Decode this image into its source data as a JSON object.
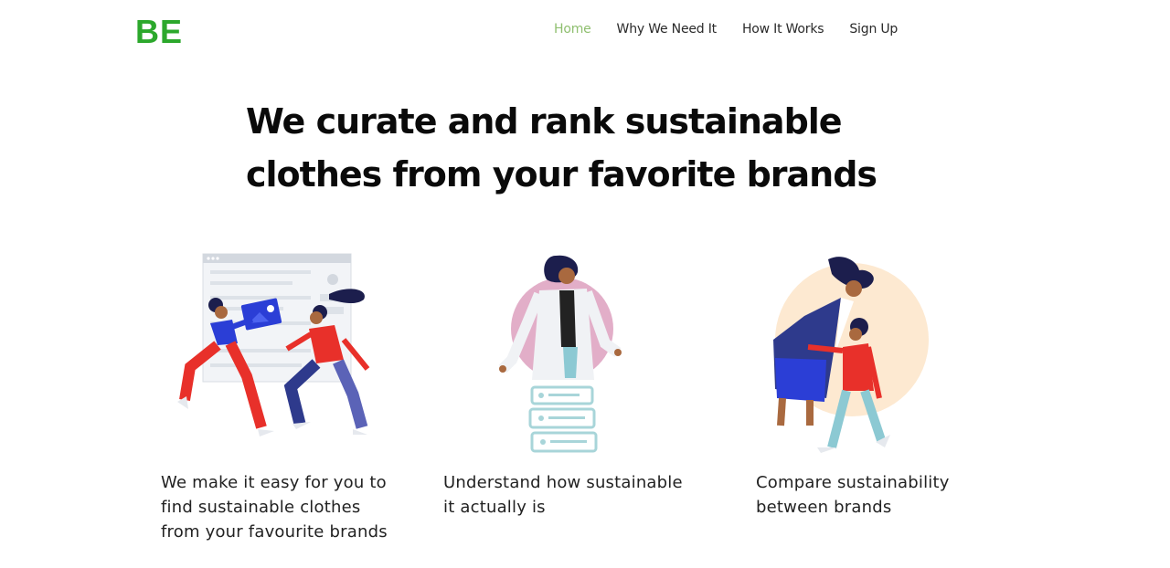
{
  "brand": {
    "logo_text": "BE",
    "accent": "#2ca82c"
  },
  "nav": {
    "items": [
      {
        "label": "Home",
        "active": true
      },
      {
        "label": "Why We Need It",
        "active": false
      },
      {
        "label": "How It Works",
        "active": false
      },
      {
        "label": "Sign Up",
        "active": false
      }
    ],
    "active_color": "#8fbf6f"
  },
  "hero": {
    "headline_line1": "We curate and rank sustainable",
    "headline_line2": "clothes from your favorite brands"
  },
  "features": [
    {
      "illustration": "two-people-sharing-webpage-illustration",
      "line1": "We make it easy for you to",
      "line2": "find sustainable clothes",
      "line3": "from your favourite brands"
    },
    {
      "illustration": "person-with-documents-illustration",
      "line1": "Understand how sustainable",
      "line2": "it actually is"
    },
    {
      "illustration": "mother-and-child-illustration",
      "line1": "Compare sustainability",
      "line2": "between brands"
    }
  ]
}
